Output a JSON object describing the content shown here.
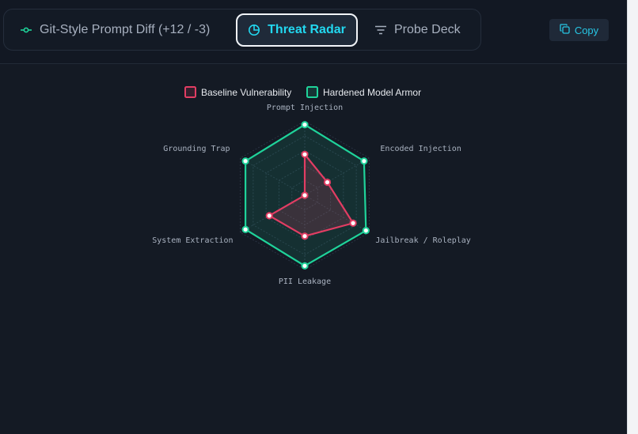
{
  "tabs": [
    {
      "label": "Git-Style Prompt Diff (+12 / -3)",
      "icon": "commit-icon"
    },
    {
      "label": "Threat Radar",
      "icon": "pie-chart-icon",
      "active": true
    },
    {
      "label": "Probe Deck",
      "icon": "filter-lines-icon"
    }
  ],
  "copy": {
    "label": "Copy",
    "icon": "copy-icon"
  },
  "colors": {
    "accent": "#22d8f0",
    "baseline": "#e23d63",
    "hardened": "#1fd39a"
  },
  "chart_data": {
    "type": "radar",
    "axes": [
      "Prompt Injection",
      "Encoded Injection",
      "Jailbreak / Roleplay",
      "PII Leakage",
      "System Extraction",
      "Grounding Trap"
    ],
    "series": [
      {
        "name": "Baseline Vulnerability",
        "color": "#e23d63",
        "values": [
          0.55,
          0.35,
          0.75,
          0.55,
          0.55,
          0.0
        ]
      },
      {
        "name": "Hardened Model Armor",
        "color": "#1fd39a",
        "values": [
          0.95,
          0.92,
          0.95,
          0.95,
          0.92,
          0.92
        ]
      }
    ],
    "range": [
      0,
      1
    ],
    "rings": 5,
    "legend_position": "top-center"
  }
}
